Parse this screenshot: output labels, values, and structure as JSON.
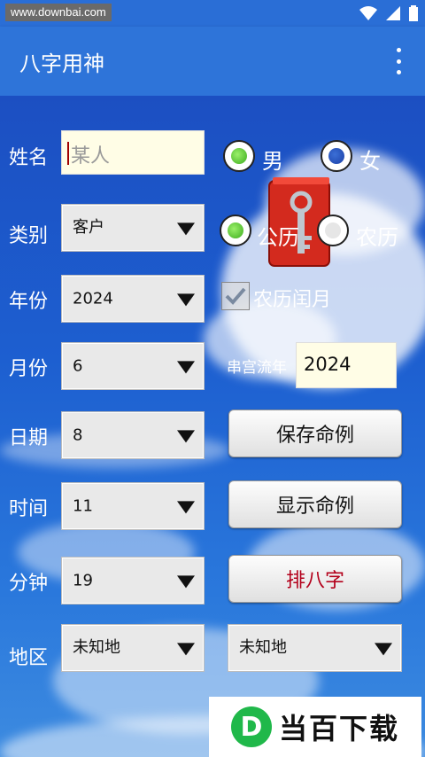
{
  "status_bar": {
    "watermark": "www.downbai.com",
    "icons": [
      "wifi-icon",
      "signal-icon",
      "battery-icon"
    ]
  },
  "app_bar": {
    "title": "八字用神",
    "menu_icon": "more-vert-icon"
  },
  "form": {
    "name": {
      "label": "姓名",
      "placeholder": "某人"
    },
    "gender": {
      "male": "男",
      "female": "女",
      "selected": "男"
    },
    "category": {
      "label": "类别",
      "value": "客户"
    },
    "calendar": {
      "solar": "公历",
      "lunar": "农历",
      "selected": "公历"
    },
    "year": {
      "label": "年份",
      "value": "2024"
    },
    "leap_month": {
      "label": "农历闰月"
    },
    "month": {
      "label": "月份",
      "value": "6"
    },
    "flow_year": {
      "label": "串宫流年",
      "value": "2024"
    },
    "day": {
      "label": "日期",
      "value": "8"
    },
    "hour": {
      "label": "时间",
      "value": "11"
    },
    "minute": {
      "label": "分钟",
      "value": "19"
    },
    "region": {
      "label": "地区",
      "value": "未知地",
      "value2": "未知地"
    }
  },
  "buttons": {
    "save": "保存命例",
    "show": "显示命例",
    "calc": "排八字"
  },
  "footer_logo": {
    "letter": "D",
    "text": "当百下载"
  },
  "colors": {
    "app_bar": "#2e74d9",
    "calc_text": "#b3001b",
    "radio_on": "#3cab1d"
  }
}
